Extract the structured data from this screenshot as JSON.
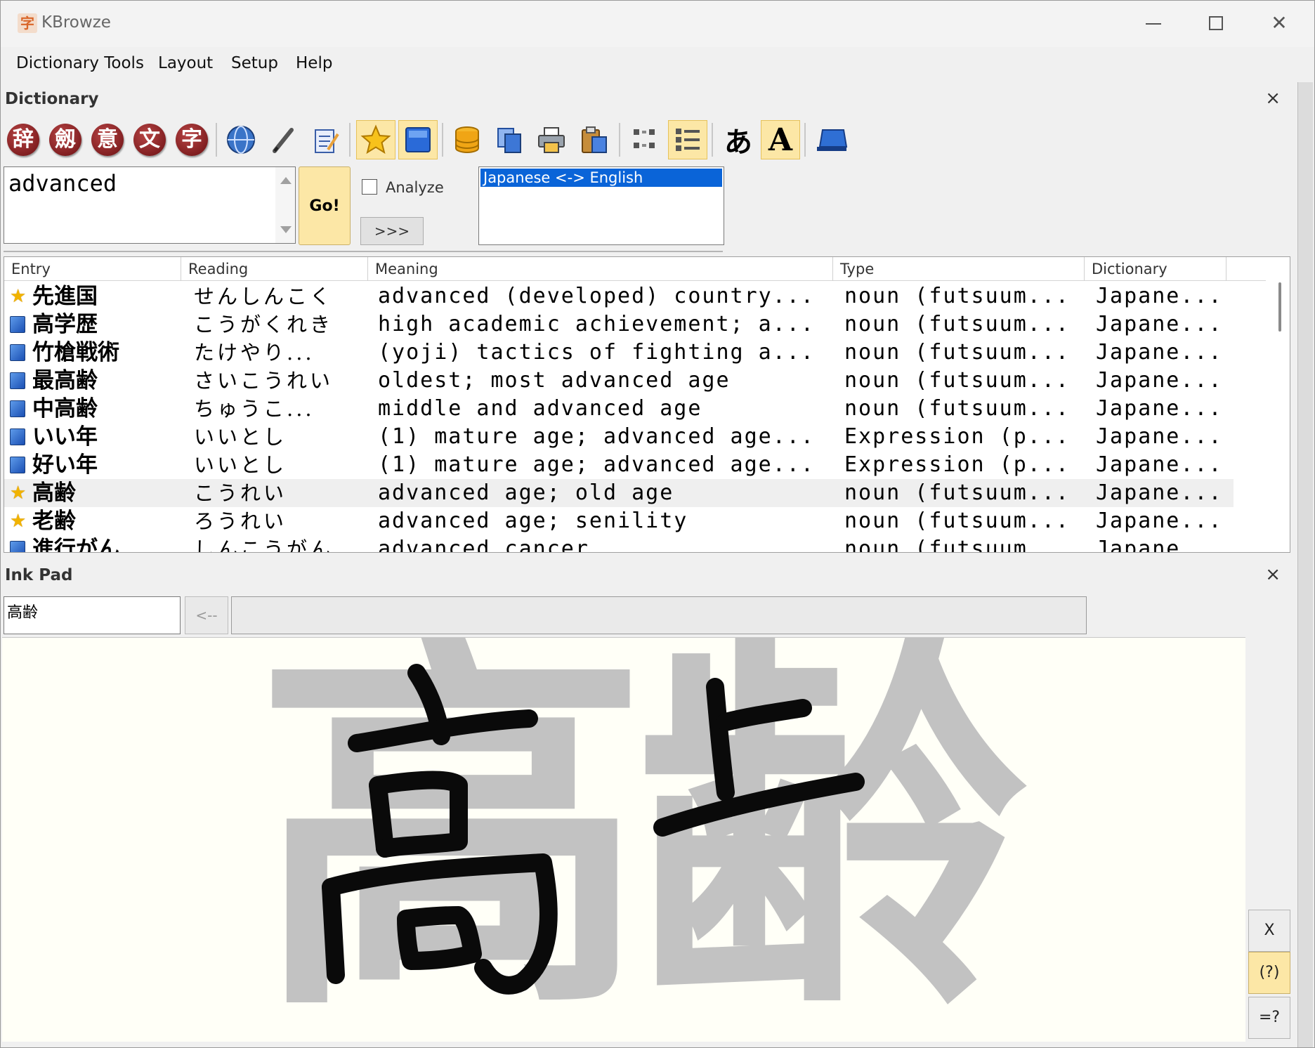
{
  "window": {
    "title": "KBrowze",
    "app_icon": "字"
  },
  "menu": [
    "Dictionary Tools",
    "Layout",
    "Setup",
    "Help"
  ],
  "dictionary_panel": {
    "title": "Dictionary",
    "close": "×",
    "toolbar": {
      "kanji_buttons": [
        "辞",
        "劔",
        "意",
        "文",
        "字"
      ],
      "kana_button": "あ",
      "font_button": "A"
    },
    "search": {
      "value": "advanced",
      "go_label": "Go!",
      "analyze_label": "Analyze",
      "more_label": ">>>"
    },
    "dictionaries": [
      "Japanese <-> English"
    ],
    "columns": [
      "Entry",
      "Reading",
      "Meaning",
      "Type",
      "Dictionary"
    ],
    "rows": [
      {
        "icon": "star",
        "entry": "先進国",
        "reading": "せんしんこく",
        "meaning": "advanced (developed) country...",
        "type": "noun (futsuum...",
        "dict": "Japane..."
      },
      {
        "icon": "book",
        "entry": "高学歴",
        "reading": "こうがくれき",
        "meaning": "high academic achievement; a...",
        "type": "noun (futsuum...",
        "dict": "Japane..."
      },
      {
        "icon": "book",
        "entry": "竹槍戦術",
        "reading": "たけやり...",
        "meaning": "(yoji) tactics of fighting a...",
        "type": "noun (futsuum...",
        "dict": "Japane..."
      },
      {
        "icon": "book",
        "entry": "最高齢",
        "reading": "さいこうれい",
        "meaning": "oldest; most advanced age",
        "type": "noun (futsuum...",
        "dict": "Japane..."
      },
      {
        "icon": "book",
        "entry": "中高齢",
        "reading": "ちゅうこ...",
        "meaning": "middle and advanced age",
        "type": "noun (futsuum...",
        "dict": "Japane..."
      },
      {
        "icon": "book",
        "entry": "いい年",
        "reading": "いいとし",
        "meaning": "(1) mature age; advanced age...",
        "type": "Expression (p...",
        "dict": "Japane..."
      },
      {
        "icon": "book",
        "entry": "好い年",
        "reading": "いいとし",
        "meaning": "(1) mature age; advanced age...",
        "type": "Expression (p...",
        "dict": "Japane..."
      },
      {
        "icon": "star",
        "entry": "高齢",
        "reading": "こうれい",
        "meaning": "advanced age; old age",
        "type": "noun (futsuum...",
        "dict": "Japane..."
      },
      {
        "icon": "star",
        "entry": "老齢",
        "reading": "ろうれい",
        "meaning": "advanced age; senility",
        "type": "noun (futsuum...",
        "dict": "Japane..."
      },
      {
        "icon": "book",
        "entry": "進行がん",
        "reading": "しんこうがん",
        "meaning": "advanced cancer",
        "type": "noun (futsuum...",
        "dict": "Japane..."
      }
    ]
  },
  "ink_pad": {
    "title": "Ink Pad",
    "close": "×",
    "input_value": "高齢",
    "back_label": "<--",
    "guide_chars": "高齢",
    "side_buttons": [
      "X",
      "(?)",
      "=?"
    ]
  },
  "colors": {
    "highlight": "#fce7a6",
    "selection": "#0a64d8",
    "kanji_button": "#8a1a1e"
  }
}
